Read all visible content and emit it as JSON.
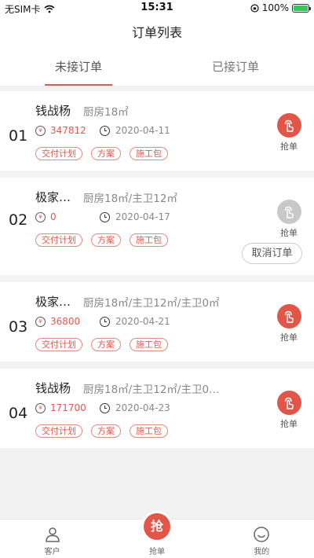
{
  "status_bar": {
    "carrier": "无SIM卡",
    "time": "15:31",
    "battery": "100%"
  },
  "nav": {
    "title": "订单列表"
  },
  "tabs": [
    {
      "label": "未接订单",
      "active": true
    },
    {
      "label": "已接订单",
      "active": false
    }
  ],
  "orders": [
    {
      "no": "01",
      "name": "钱战杨",
      "rooms": "厨房18㎡",
      "price": "347812",
      "date": "2020-04-11",
      "tags": [
        "交付计划",
        "方案",
        "施工包"
      ],
      "action": "抢单",
      "action_state": "active"
    },
    {
      "no": "02",
      "name": "极家…",
      "rooms": "厨房18㎡/主卫12㎡",
      "price": "0",
      "date": "2020-04-17",
      "tags": [
        "交付计划",
        "方案",
        "施工包"
      ],
      "action": "抢单",
      "action_state": "disabled",
      "cancel_label": "取消订单"
    },
    {
      "no": "03",
      "name": "极家…",
      "rooms": "厨房18㎡/主卫12㎡/主卫0㎡",
      "price": "36800",
      "date": "2020-04-21",
      "tags": [
        "交付计划",
        "方案",
        "施工包"
      ],
      "action": "抢单",
      "action_state": "active"
    },
    {
      "no": "04",
      "name": "钱战杨",
      "rooms": "厨房18㎡/主卫12㎡/主卫0…",
      "price": "171700",
      "date": "2020-04-23",
      "tags": [
        "交付计划",
        "方案",
        "施工包"
      ],
      "action": "抢单",
      "action_state": "active"
    }
  ],
  "bottom_bar": {
    "items": [
      {
        "label": "客户",
        "icon": "customer-icon"
      },
      {
        "label": "抢单",
        "icon": "grab-order-icon",
        "badge": "抢"
      },
      {
        "label": "我的",
        "icon": "smiley-icon"
      }
    ]
  },
  "colors": {
    "accent": "#e25549",
    "inactive": "#c8c8c8"
  }
}
